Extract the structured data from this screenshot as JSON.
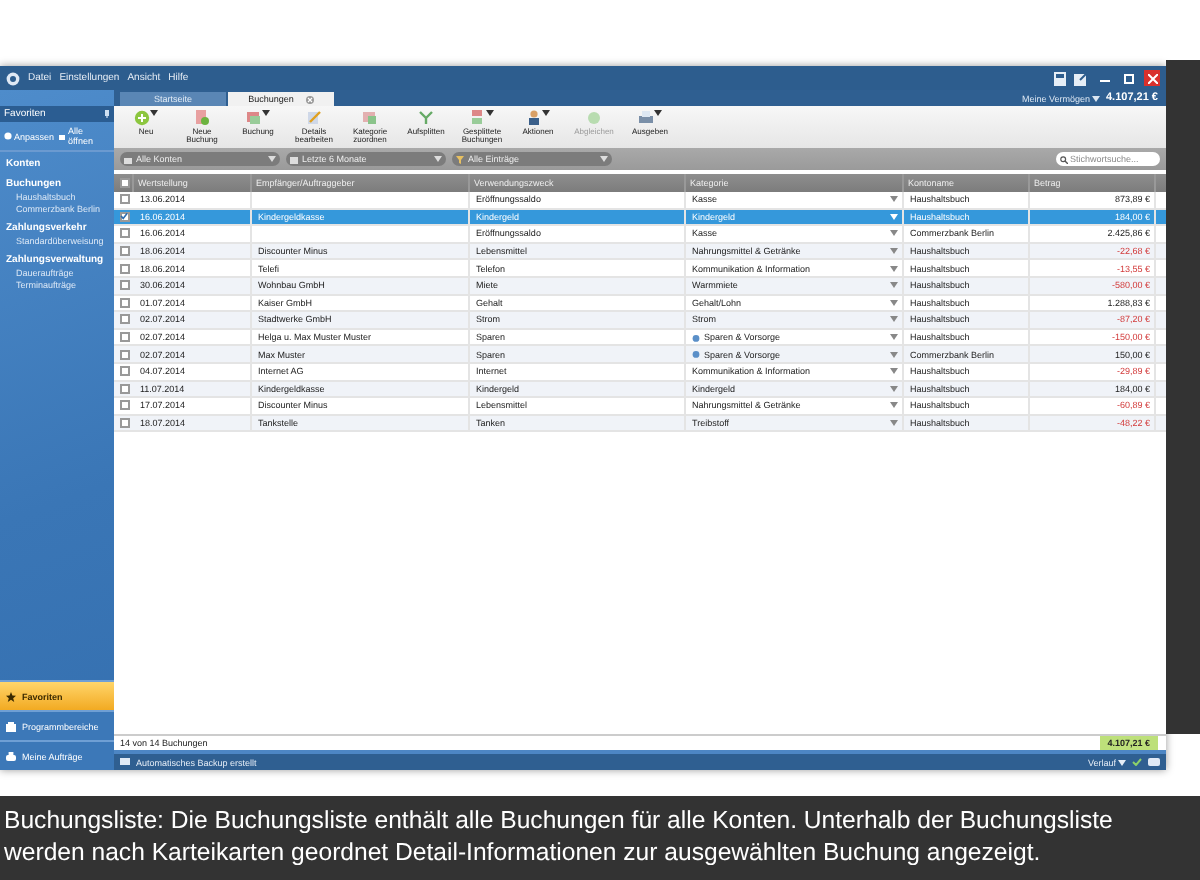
{
  "menu": [
    "Datei",
    "Einstellungen",
    "Ansicht",
    "Hilfe"
  ],
  "tabs": [
    {
      "label": "Startseite",
      "selected": false
    },
    {
      "label": "Buchungen",
      "selected": true
    }
  ],
  "balance": {
    "label": "Meine Vermögen",
    "value": "4.107,21 €"
  },
  "toolbar": [
    {
      "label": "Neu",
      "dropdown": true,
      "disabled": false
    },
    {
      "label": "Neue Buchung",
      "dropdown": false,
      "disabled": false
    },
    {
      "label": "Buchung",
      "dropdown": true,
      "disabled": false
    },
    {
      "label": "Details bearbeiten",
      "dropdown": false,
      "disabled": false
    },
    {
      "label": "Kategorie zuordnen",
      "dropdown": false,
      "disabled": false
    },
    {
      "label": "Aufsplitten",
      "dropdown": false,
      "disabled": false
    },
    {
      "label": "Gesplittete Buchungen",
      "dropdown": true,
      "disabled": false
    },
    {
      "label": "Aktionen",
      "dropdown": true,
      "disabled": false
    },
    {
      "label": "Abgleichen",
      "dropdown": false,
      "disabled": true
    },
    {
      "label": "Ausgeben",
      "dropdown": true,
      "disabled": false
    }
  ],
  "filters": [
    "Alle Konten",
    "Letzte 6 Monate",
    "Alle Einträge"
  ],
  "search": {
    "placeholder": "Stichwortsuche..."
  },
  "sidebar": {
    "title": "Favoriten",
    "actions": [
      "Anpassen",
      "Alle öffnen"
    ],
    "groups": [
      {
        "label": "Konten"
      },
      {
        "label": "Buchungen",
        "children": [
          "Haushaltsbuch",
          "Commerzbank Berlin"
        ]
      },
      {
        "label": "Zahlungsverkehr",
        "children": [
          "Standardüberweisung"
        ]
      },
      {
        "label": "Zahlungsverwaltung",
        "children": [
          "Daueraufträge",
          "Terminaufträge"
        ]
      }
    ]
  },
  "nav": [
    {
      "label": "Favoriten",
      "selected": true
    },
    {
      "label": "Programmbereiche",
      "selected": false
    },
    {
      "label": "Meine Aufträge",
      "selected": false
    }
  ],
  "table": {
    "all_checked": false,
    "columns": [
      "Wertstellung",
      "Empfänger/Auftraggeber",
      "Verwendungszweck",
      "Kategorie",
      "Kontoname",
      "Betrag"
    ],
    "rows": [
      {
        "checked": false,
        "selected": false,
        "negative": false,
        "flag": false,
        "cells": [
          "13.06.2014",
          "",
          "Eröffnungssaldo",
          "Kasse",
          "Haushaltsbuch",
          "873,89 €"
        ]
      },
      {
        "checked": true,
        "selected": true,
        "negative": false,
        "flag": false,
        "cells": [
          "16.06.2014",
          "Kindergeldkasse",
          "Kindergeld",
          "Kindergeld",
          "Haushaltsbuch",
          "184,00 €"
        ]
      },
      {
        "checked": false,
        "selected": false,
        "negative": false,
        "flag": false,
        "cells": [
          "16.06.2014",
          "",
          "Eröffnungssaldo",
          "Kasse",
          "Commerzbank Berlin",
          "2.425,86 €"
        ]
      },
      {
        "checked": false,
        "selected": false,
        "negative": true,
        "flag": false,
        "cells": [
          "18.06.2014",
          "Discounter Minus",
          "Lebensmittel",
          "Nahrungsmittel & Getränke",
          "Haushaltsbuch",
          "-22,68 €"
        ]
      },
      {
        "checked": false,
        "selected": false,
        "negative": true,
        "flag": false,
        "cells": [
          "18.06.2014",
          "Telefi",
          "Telefon",
          "Kommunikation & Information",
          "Haushaltsbuch",
          "-13,55 €"
        ]
      },
      {
        "checked": false,
        "selected": false,
        "negative": true,
        "flag": false,
        "cells": [
          "30.06.2014",
          "Wohnbau GmbH",
          "Miete",
          "Warmmiete",
          "Haushaltsbuch",
          "-580,00 €"
        ]
      },
      {
        "checked": false,
        "selected": false,
        "negative": false,
        "flag": false,
        "cells": [
          "01.07.2014",
          "Kaiser GmbH",
          "Gehalt",
          "Gehalt/Lohn",
          "Haushaltsbuch",
          "1.288,83 €"
        ]
      },
      {
        "checked": false,
        "selected": false,
        "negative": true,
        "flag": false,
        "cells": [
          "02.07.2014",
          "Stadtwerke GmbH",
          "Strom",
          "Strom",
          "Haushaltsbuch",
          "-87,20 €"
        ]
      },
      {
        "checked": false,
        "selected": false,
        "negative": true,
        "flag": true,
        "cells": [
          "02.07.2014",
          "Helga u. Max Muster Muster",
          "Sparen",
          "Sparen & Vorsorge",
          "Haushaltsbuch",
          "-150,00 €"
        ]
      },
      {
        "checked": false,
        "selected": false,
        "negative": false,
        "flag": true,
        "cells": [
          "02.07.2014",
          "Max Muster",
          "Sparen",
          "Sparen & Vorsorge",
          "Commerzbank Berlin",
          "150,00 €"
        ]
      },
      {
        "checked": false,
        "selected": false,
        "negative": true,
        "flag": false,
        "cells": [
          "04.07.2014",
          "Internet AG",
          "Internet",
          "Kommunikation & Information",
          "Haushaltsbuch",
          "-29,89 €"
        ]
      },
      {
        "checked": false,
        "selected": false,
        "negative": false,
        "flag": false,
        "cells": [
          "11.07.2014",
          "Kindergeldkasse",
          "Kindergeld",
          "Kindergeld",
          "Haushaltsbuch",
          "184,00 €"
        ]
      },
      {
        "checked": false,
        "selected": false,
        "negative": true,
        "flag": false,
        "cells": [
          "17.07.2014",
          "Discounter Minus",
          "Lebensmittel",
          "Nahrungsmittel & Getränke",
          "Haushaltsbuch",
          "-60,89 €"
        ]
      },
      {
        "checked": false,
        "selected": false,
        "negative": true,
        "flag": false,
        "cells": [
          "18.07.2014",
          "Tankstelle",
          "Tanken",
          "Treibstoff",
          "Haushaltsbuch",
          "-48,22 €"
        ]
      }
    ]
  },
  "footer": {
    "count": "14 von 14 Buchungen",
    "total": "4.107,21 €"
  },
  "status_bar": {
    "message": "Automatisches Backup erstellt",
    "history": "Verlauf"
  },
  "caption": "Buchungsliste: Die Buchungsliste enthält alle Buchungen für alle Konten. Unterhalb der Buchungsliste werden nach Karteikarten geordnet Detail-Informationen zur ausgewählten Buchung angezeigt."
}
